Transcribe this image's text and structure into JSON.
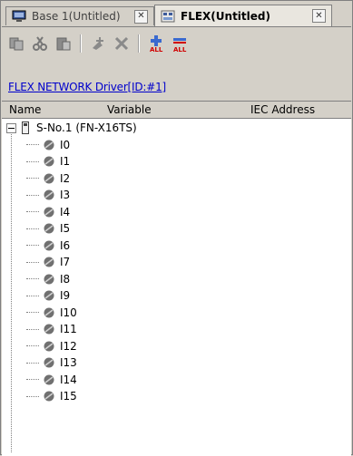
{
  "tabs": [
    {
      "label": "Base 1(Untitled)",
      "icon": "monitor-icon",
      "active": false
    },
    {
      "label": "FLEX(Untitled)",
      "icon": "flex-icon",
      "active": true
    }
  ],
  "toolbar": {
    "buttons": [
      "copy-icon",
      "cut-icon",
      "paste-icon",
      "add-icon",
      "delete-icon",
      "add-all-icon",
      "remove-all-icon"
    ]
  },
  "driver_link": "FLEX NETWORK Driver[ID:#1]",
  "columns": {
    "name": "Name",
    "variable": "Variable",
    "iec": "IEC Address"
  },
  "tree": {
    "root": "S-No.1 (FN-X16TS)",
    "items": [
      "I0",
      "I1",
      "I2",
      "I3",
      "I4",
      "I5",
      "I6",
      "I7",
      "I8",
      "I9",
      "I10",
      "I11",
      "I12",
      "I13",
      "I14",
      "I15"
    ]
  }
}
